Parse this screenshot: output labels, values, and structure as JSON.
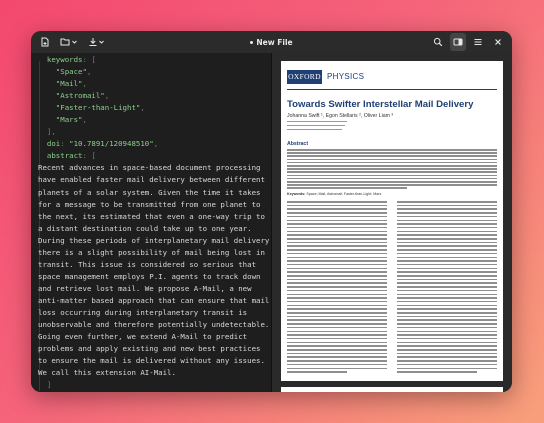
{
  "window": {
    "title": "New File",
    "unsaved_indicator": "•",
    "icons": [
      "new-document-icon",
      "open-folder-icon",
      "chevron-down-icon",
      "download-icon",
      "chevron-down-icon",
      "search-icon",
      "sidebar-toggle-icon",
      "hamburger-menu-icon",
      "close-icon"
    ]
  },
  "editor": {
    "lines": [
      [
        {
          "c": "k",
          "t": "  keywords"
        },
        {
          "c": "p",
          "t": ": ["
        }
      ],
      [
        {
          "c": "s",
          "t": "    \"Space\""
        },
        {
          "c": "p",
          "t": ","
        }
      ],
      [
        {
          "c": "s",
          "t": "    \"Mail\""
        },
        {
          "c": "p",
          "t": ","
        }
      ],
      [
        {
          "c": "s",
          "t": "    \"Astromail\""
        },
        {
          "c": "p",
          "t": ","
        }
      ],
      [
        {
          "c": "s",
          "t": "    \"Faster-than-Light\""
        },
        {
          "c": "p",
          "t": ","
        }
      ],
      [
        {
          "c": "s",
          "t": "    \"Mars\""
        },
        {
          "c": "p",
          "t": ","
        }
      ],
      [
        {
          "c": "p",
          "t": "  ],"
        }
      ],
      [
        {
          "c": "k",
          "t": "  doi"
        },
        {
          "c": "p",
          "t": ": "
        },
        {
          "c": "s",
          "t": "\"10.7891/120948510\""
        },
        {
          "c": "p",
          "t": ","
        }
      ],
      [
        {
          "c": "k",
          "t": "  abstract"
        },
        {
          "c": "p",
          "t": ": ["
        }
      ],
      [
        {
          "c": "t",
          "t": "Recent advances in space-based document processing"
        }
      ],
      [
        {
          "c": "t",
          "t": "have enabled faster mail delivery between different"
        }
      ],
      [
        {
          "c": "t",
          "t": "planets of a solar system. Given the time it takes"
        }
      ],
      [
        {
          "c": "t",
          "t": "for a message to be transmitted from one planet to"
        }
      ],
      [
        {
          "c": "t",
          "t": "the next, its estimated that even a one-way trip to"
        }
      ],
      [
        {
          "c": "t",
          "t": "a distant destination could take up to one year."
        }
      ],
      [
        {
          "c": "t",
          "t": "During these periods of interplanetary mail delivery"
        }
      ],
      [
        {
          "c": "t",
          "t": "there is a slight possibility of mail being lost in"
        }
      ],
      [
        {
          "c": "t",
          "t": "transit. This issue is considered so serious that"
        }
      ],
      [
        {
          "c": "t",
          "t": "space management employs P.I. agents to track down"
        }
      ],
      [
        {
          "c": "t",
          "t": "and retrieve lost mail. We propose A-Mail, a new"
        }
      ],
      [
        {
          "c": "t",
          "t": "anti-matter based approach that can ensure that mail"
        }
      ],
      [
        {
          "c": "t",
          "t": "loss occurring during interplanetary transit is"
        }
      ],
      [
        {
          "c": "t",
          "t": "unobservable and therefore potentially undetectable."
        }
      ],
      [
        {
          "c": "t",
          "t": "Going even further, we extend A-Mail to predict"
        }
      ],
      [
        {
          "c": "t",
          "t": "problems and apply existing and new best practices"
        }
      ],
      [
        {
          "c": "t",
          "t": "to ensure the mail is delivered without any issues."
        }
      ],
      [
        {
          "c": "t",
          "t": "We call this extension AI-Mail."
        }
      ],
      [
        {
          "c": "p",
          "t": "  ]"
        }
      ],
      [
        {
          "c": "p",
          "t": "}"
        }
      ]
    ]
  },
  "preview": {
    "logo": "OXFORD",
    "publisher_section": "PHYSICS",
    "title": "Towards Swifter Interstellar Mail Delivery",
    "authors": "Johanna Swift ¹, Egon Stellaris ², Oliver Liam ³",
    "abstract_heading": "Abstract",
    "keywords_label": "Keywords:",
    "keywords_text": "Space; Mail; Astromail; Faster-than-Light; Mars"
  },
  "colors": {
    "accent": "#1f3f75",
    "code_green": "#8bd08b",
    "background_start": "#f3486f",
    "background_end": "#f8a07a"
  }
}
